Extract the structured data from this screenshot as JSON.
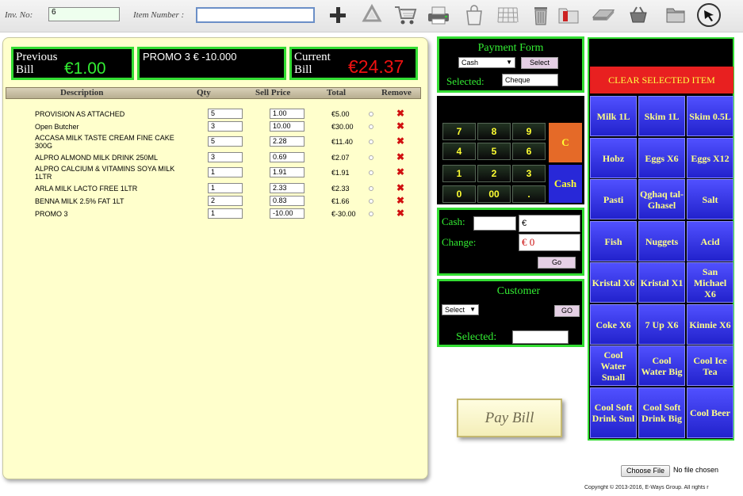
{
  "topbar": {
    "inv_label": "Inv. No:",
    "inv_value": "6",
    "item_label": "Item Number :",
    "item_value": "",
    "tools": [
      "plus-icon",
      "recycle-icon",
      "cart-icon",
      "printer-icon",
      "bag-icon",
      "grid-icon",
      "trash-icon",
      "folder-red-icon",
      "scanner-icon",
      "basket-icon",
      "folder-icon",
      "cursor-icon"
    ]
  },
  "bill": {
    "prev_label_1": "Previous",
    "prev_label_2": "Bill",
    "prev_value": "€1.00",
    "promo_text": "PROMO 3 € -10.000",
    "curr_label_1": "Current",
    "curr_label_2": "Bill",
    "curr_value": "€24.37",
    "columns": {
      "desc": "Description",
      "qty": "Qty",
      "price": "Sell Price",
      "total": "Total",
      "remove": "Remove"
    },
    "rows": [
      {
        "desc": "PROVISION AS ATTACHED",
        "qty": "5",
        "price": "1.00",
        "total": "€5.00"
      },
      {
        "desc": "Open Butcher",
        "qty": "3",
        "price": "10.00",
        "total": "€30.00"
      },
      {
        "desc": "ACCASA MILK TASTE CREAM FINE CAKE 300G",
        "qty": "5",
        "price": "2.28",
        "total": "€11.40"
      },
      {
        "desc": "ALPRO ALMOND MILK DRINK 250ML",
        "qty": "3",
        "price": "0.69",
        "total": "€2.07"
      },
      {
        "desc": "ALPRO CALCIUM & VITAMINS SOYA MILK 1LTR",
        "qty": "1",
        "price": "1.91",
        "total": "€1.91"
      },
      {
        "desc": "ARLA MILK LACTO FREE 1LTR",
        "qty": "1",
        "price": "2.33",
        "total": "€2.33"
      },
      {
        "desc": "BENNA MILK 2.5% FAT 1LT",
        "qty": "2",
        "price": "0.83",
        "total": "€1.66"
      },
      {
        "desc": "PROMO 3",
        "qty": "1",
        "price": "-10.00",
        "total": "€-30.00"
      }
    ]
  },
  "payment": {
    "title": "Payment Form",
    "method": "Cash",
    "select_btn": "Select",
    "selected_label": "Selected:",
    "selected_value": "Cheque"
  },
  "keypad": {
    "keys": [
      "7",
      "8",
      "9",
      "4",
      "5",
      "6",
      "1",
      "2",
      "3",
      "0",
      "00",
      "."
    ],
    "clear": "C",
    "cash": "Cash"
  },
  "cash": {
    "cash_label": "Cash:",
    "cash_value": "",
    "cash_euro": "€",
    "change_label": "Change:",
    "change_value": "€ 0",
    "go": "Go"
  },
  "customer": {
    "title": "Customer",
    "select": "Select",
    "go": "GO",
    "selected_label": "Selected:",
    "selected_value": ""
  },
  "products": {
    "clear_label": "CLEAR SELECTED ITEM",
    "items": [
      "Milk 1L",
      "Skim 1L",
      "Skim 0.5L",
      "Hobz",
      "Eggs X6",
      "Eggs X12",
      "Pasti",
      "Qghaq tal-Ghasel",
      "Salt",
      "Fish",
      "Nuggets",
      "Acid",
      "Kristal X6",
      "Kristal X1",
      "San Michael X6",
      "Coke X6",
      "7 Up X6",
      "Kinnie X6",
      "Cool Water Small",
      "Cool Water Big",
      "Cool Ice Tea",
      "Cool Soft Drink Sml",
      "Cool Soft Drink Big",
      "Cool Beer"
    ]
  },
  "pay_bill": "Pay Bill",
  "file": {
    "button": "Choose File",
    "status": "No file chosen"
  },
  "copyright": "Copyright © 2013-2016, E-Ways Group. All rights r",
  "colors": {
    "green_border": "#33dd33",
    "prev_value": "#33ee33",
    "curr_value": "#ee1111",
    "product": "#3333ee",
    "clear": "#e82020"
  }
}
